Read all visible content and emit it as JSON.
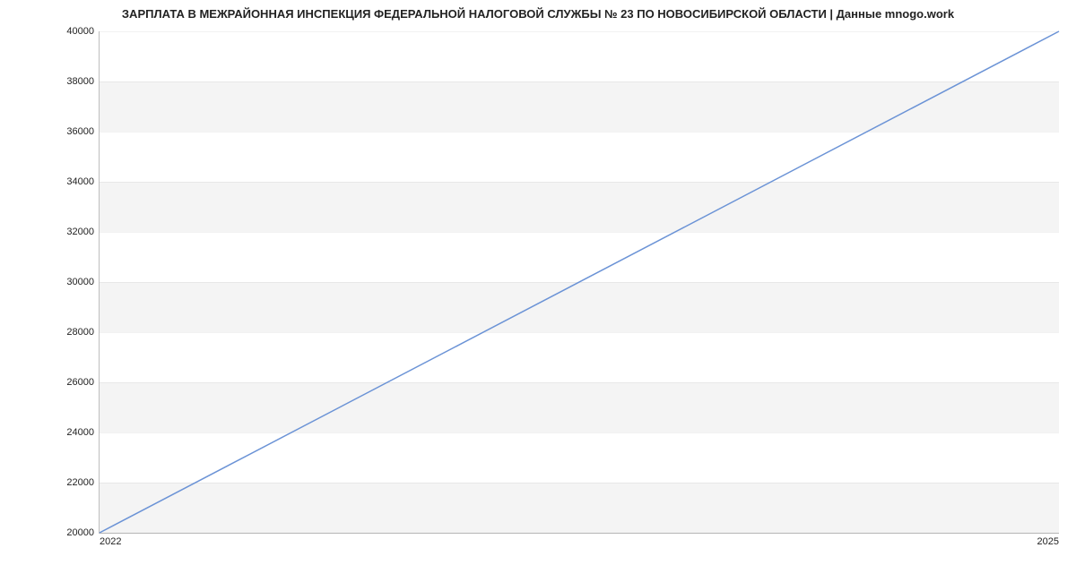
{
  "chart_data": {
    "type": "line",
    "title": "ЗАРПЛАТА В МЕЖРАЙОННАЯ ИНСПЕКЦИЯ ФЕДЕРАЛЬНОЙ НАЛОГОВОЙ СЛУЖБЫ № 23 ПО НОВОСИБИРСКОЙ ОБЛАСТИ | Данные mnogo.work",
    "xlabel": "",
    "ylabel": "",
    "x": [
      2022,
      2025
    ],
    "values": [
      20000,
      40000
    ],
    "xlim": [
      2022,
      2025
    ],
    "ylim": [
      20000,
      40000
    ],
    "yticks": [
      20000,
      22000,
      24000,
      26000,
      28000,
      30000,
      32000,
      34000,
      36000,
      38000,
      40000
    ],
    "xticks": [
      2022,
      2025
    ]
  },
  "colors": {
    "line": "#6b93d6"
  }
}
